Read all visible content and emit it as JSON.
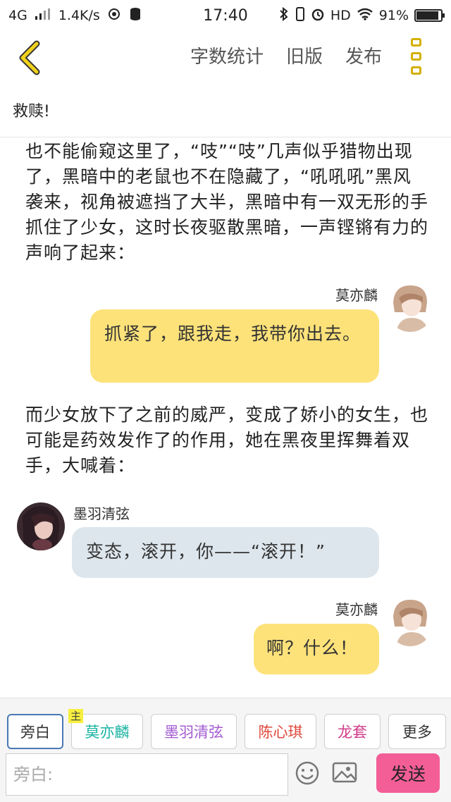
{
  "status_bar": {
    "network": "4G",
    "speed": "1.4K/s",
    "time": "17:40",
    "hd": "HD",
    "battery_text": "91%",
    "battery_level": 0.91
  },
  "header": {
    "word_count": "字数统计",
    "old_version": "旧版",
    "publish": "发布"
  },
  "chapter_title": "救赎!",
  "story": [
    {
      "type": "narration",
      "text": "也不能偷窥这里了，“吱”“吱”几声似乎猎物出现了，黑暗中的老鼠也不在隐藏了，“吼吼吼”黑风袭来，视角被遮挡了大半，黑暗中有一双无形的手抓住了少女，这时长夜驱散黑暗，一声铿锵有力的声响了起来："
    },
    {
      "type": "message",
      "side": "right",
      "name": "莫亦麟",
      "text": "抓紧了，跟我走，我带你出去。"
    },
    {
      "type": "narration",
      "text": "而少女放下了之前的威严，变成了娇小的女生，也可能是药效发作了的作用，她在黑夜里挥舞着双手，大喊着："
    },
    {
      "type": "message",
      "side": "left",
      "name": "墨羽清弦",
      "text": "变态，滚开，你——“滚开！”"
    },
    {
      "type": "message",
      "side": "right",
      "name": "莫亦麟",
      "text": "啊？什么！"
    }
  ],
  "roles": [
    {
      "label": "旁白",
      "color": "#333333",
      "active": true
    },
    {
      "label": "莫亦麟",
      "color": "#1bb3a3",
      "badge": "主"
    },
    {
      "label": "墨羽清弦",
      "color": "#a35bd0"
    },
    {
      "label": "陈心琪",
      "color": "#e0473a"
    },
    {
      "label": "龙套",
      "color": "#d23c8a"
    },
    {
      "label": "更多",
      "color": "#333333"
    }
  ],
  "input": {
    "placeholder": "旁白:"
  },
  "send_label": "发送",
  "colors": {
    "accent_yellow": "#fde27a",
    "send_pink": "#f35e97",
    "bubble_gray": "#dde6ec"
  }
}
